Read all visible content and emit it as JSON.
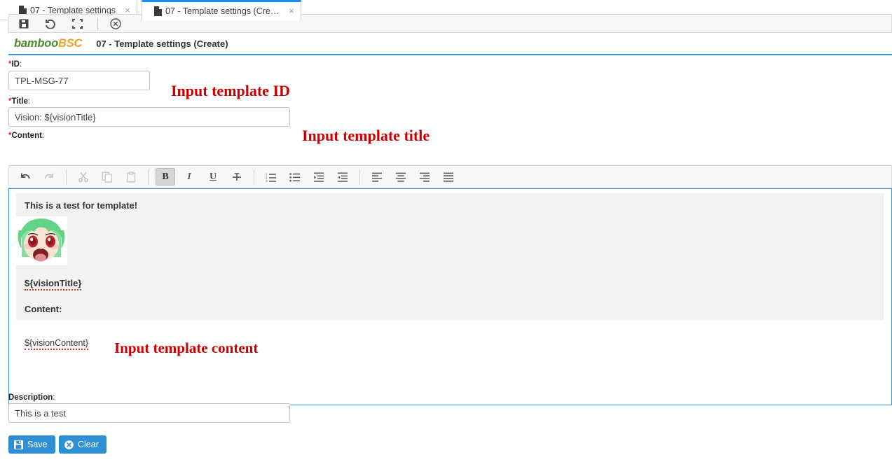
{
  "browser": {
    "tabs": [
      {
        "label": "07 - Template settings",
        "icon": "document-icon",
        "close": "×",
        "active": false
      },
      {
        "label": "07 - Template settings (Create)",
        "icon": "document-icon",
        "close": "×",
        "active": true
      }
    ]
  },
  "app_toolbar": {
    "icons": [
      "save-icon",
      "refresh-icon",
      "expand-icon",
      "close-circle-icon"
    ]
  },
  "header": {
    "logo_primary": "bamboo",
    "logo_secondary": "BSC",
    "title": "07 - Template settings (Create)",
    "accent_color": "#3498db",
    "logo_primary_color": "#4a8b2c",
    "logo_secondary_color": "#f0a32a"
  },
  "form": {
    "id_field": {
      "required_mark": "*",
      "label": "ID",
      "colon": ":",
      "value": "TPL-MSG-77",
      "placeholder": ""
    },
    "title_field": {
      "required_mark": "*",
      "label": "Title",
      "colon": ":",
      "value": "Vision: ${visionTitle}",
      "placeholder": ""
    },
    "content_field": {
      "required_mark": "*",
      "label": "Content",
      "colon": ":"
    },
    "description_field": {
      "required_mark": "",
      "label": "Description",
      "colon": ":",
      "value": "This is a test",
      "placeholder": ""
    }
  },
  "annotations": [
    {
      "text": "Input template ID",
      "color": "#cc0000"
    },
    {
      "text": "Input template title",
      "color": "#cc0000"
    },
    {
      "text": "Input template content",
      "color": "#cc0000"
    }
  ],
  "editor": {
    "toolbar": [
      {
        "name": "undo-icon",
        "title": "Undo",
        "state": "enabled"
      },
      {
        "name": "redo-icon",
        "title": "Redo",
        "state": "disabled"
      },
      {
        "name": "separator",
        "title": "",
        "state": ""
      },
      {
        "name": "cut-icon",
        "title": "Cut",
        "state": "disabled"
      },
      {
        "name": "copy-icon",
        "title": "Copy",
        "state": "disabled"
      },
      {
        "name": "paste-icon",
        "title": "Paste",
        "state": "disabled"
      },
      {
        "name": "separator",
        "title": "",
        "state": ""
      },
      {
        "name": "bold-icon",
        "title": "Bold",
        "state": "active"
      },
      {
        "name": "italic-icon",
        "title": "Italic",
        "state": "enabled"
      },
      {
        "name": "underline-icon",
        "title": "Underline",
        "state": "enabled"
      },
      {
        "name": "strikethrough-icon",
        "title": "Strikethrough",
        "state": "enabled"
      },
      {
        "name": "separator",
        "title": "",
        "state": ""
      },
      {
        "name": "numbered-list-icon",
        "title": "Numbered list",
        "state": "enabled"
      },
      {
        "name": "bulleted-list-icon",
        "title": "Bulleted list",
        "state": "enabled"
      },
      {
        "name": "indent-increase-icon",
        "title": "Increase indent",
        "state": "enabled"
      },
      {
        "name": "indent-decrease-icon",
        "title": "Decrease indent",
        "state": "enabled"
      },
      {
        "name": "separator",
        "title": "",
        "state": ""
      },
      {
        "name": "align-left-icon",
        "title": "Align left",
        "state": "enabled"
      },
      {
        "name": "align-center-icon",
        "title": "Align center",
        "state": "enabled"
      },
      {
        "name": "align-right-icon",
        "title": "Align right",
        "state": "enabled"
      },
      {
        "name": "align-justify-icon",
        "title": "Justify",
        "state": "enabled"
      }
    ],
    "document": {
      "heading": "This is a test for template!",
      "image_alt": "anime-character-image",
      "variable_title": "${visionTitle}",
      "content_label": "Content:",
      "variable_content": "${visionContent}"
    }
  },
  "actions": {
    "save": {
      "label": "Save",
      "icon": "floppy-disk-icon",
      "color": "#2d8fd5"
    },
    "clear": {
      "label": "Clear",
      "icon": "close-circle-icon",
      "color": "#2d8fd5"
    }
  }
}
